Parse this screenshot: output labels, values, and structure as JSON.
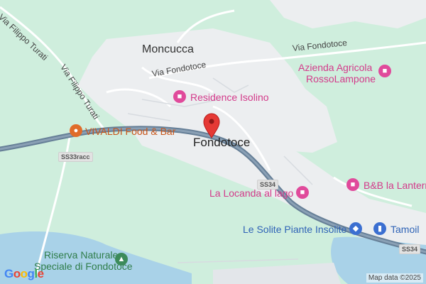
{
  "map": {
    "places": {
      "moncucca": "Moncucca",
      "fondotoce": "Fondotoce"
    },
    "roads": {
      "via_fondotoce_1": "Via Fondotoce",
      "via_fondotoce_2": "Via Fondotoce",
      "via_filippo_turati_1": "Via Filippo Turati",
      "via_filippo_turati_2": "Via Filippo Turati"
    },
    "road_badges": {
      "ss33racc": "SS33racc",
      "ss34_a": "SS34",
      "ss34_b": "SS34"
    },
    "pois": {
      "residence_isolino": "Residence Isolino",
      "azienda_line1": "Azienda Agricola",
      "azienda_line2": "RossoLampone",
      "vivaldi": "VIVALDI Food & Bar",
      "la_locanda": "La Locanda al lago",
      "bnb": "B&B la Lantern",
      "le_solite": "Le Solite Piante Insolite",
      "tamoil": "Tamoil",
      "riserva_line1": "Riserva Naturale",
      "riserva_line2": "Speciale di Fondotoce"
    },
    "icons": {
      "hotel": "hotel-bed-icon",
      "restaurant": "fork-knife-icon",
      "shop": "shopping-bag-icon",
      "fuel": "fuel-pump-icon",
      "park": "tree-icon",
      "marker": "red-map-marker-icon"
    },
    "copyright": "Map data ©2025",
    "logo": [
      "G",
      "o",
      "o",
      "g",
      "l",
      "e"
    ]
  },
  "colors": {
    "green_area": "#cfeedd",
    "urban": "#eceef0",
    "water": "#a9d2e8",
    "main_road": "#667f97",
    "marker": "#e53935",
    "hotel_pink": "#e04a9b",
    "shop_blue": "#3b6fd1",
    "restaurant_orange": "#e06c2a",
    "park_green": "#3c8b5a"
  }
}
